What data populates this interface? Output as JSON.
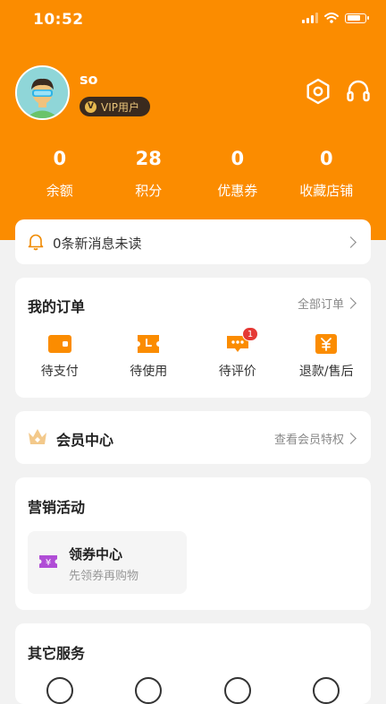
{
  "status_bar": {
    "time": "10:52"
  },
  "profile": {
    "username": "so",
    "vip_badge": "VIP用户",
    "vip_badge_letter": "V"
  },
  "stats": [
    {
      "value": "0",
      "label": "余额"
    },
    {
      "value": "28",
      "label": "积分"
    },
    {
      "value": "0",
      "label": "优惠券"
    },
    {
      "value": "0",
      "label": "收藏店铺"
    }
  ],
  "messages": {
    "text": "0条新消息未读"
  },
  "orders": {
    "title": "我的订单",
    "all_orders_link": "全部订单",
    "items": [
      {
        "label": "待支付",
        "icon": "wallet-icon"
      },
      {
        "label": "待使用",
        "icon": "ticket-icon"
      },
      {
        "label": "待评价",
        "icon": "comment-icon",
        "badge": "1"
      },
      {
        "label": "退款/售后",
        "icon": "refund-icon"
      }
    ]
  },
  "member": {
    "title": "会员中心",
    "link": "查看会员特权"
  },
  "marketing": {
    "title": "营销活动",
    "coupon_center": {
      "title": "领券中心",
      "subtitle": "先领券再购物",
      "icon_glyph": "¥"
    }
  },
  "other_services": {
    "title": "其它服务"
  },
  "colors": {
    "brand_orange": "#fb8c00",
    "badge_red": "#e53935",
    "vip_dark": "#3a2a1e",
    "coupon_purple": "#b04dd6"
  }
}
